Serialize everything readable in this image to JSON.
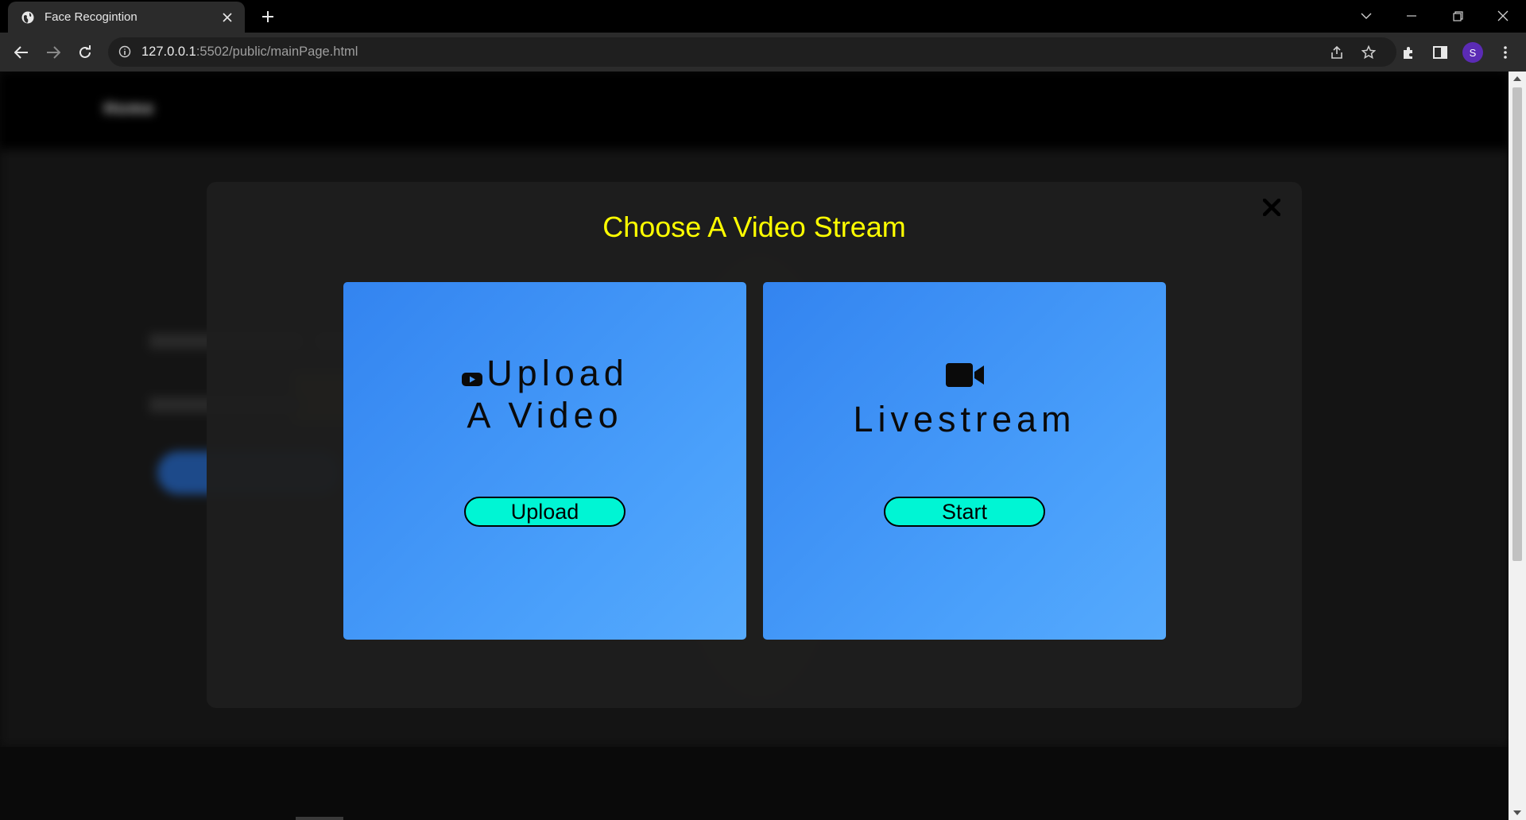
{
  "browser": {
    "tab_title": "Face Recogintion",
    "url_host": "127.0.0.1",
    "url_rest": ":5502/public/mainPage.html",
    "profile_initial": "S"
  },
  "background_site": {
    "nav_home": "Home"
  },
  "modal": {
    "title": "Choose A Video Stream",
    "close_symbol": "✕",
    "cards": [
      {
        "icon": "youtube-icon",
        "heading_line1": "Upload",
        "heading_line2": "A Video",
        "button_label": "Upload"
      },
      {
        "icon": "video-camera-icon",
        "heading_line1": "Livestream",
        "button_label": "Start"
      }
    ]
  },
  "colors": {
    "title": "#ffff00",
    "card_gradient_start": "#3384f0",
    "card_gradient_end": "#56aafc",
    "button": "#00f5d4",
    "modal_bg": "#1e1e1e"
  }
}
